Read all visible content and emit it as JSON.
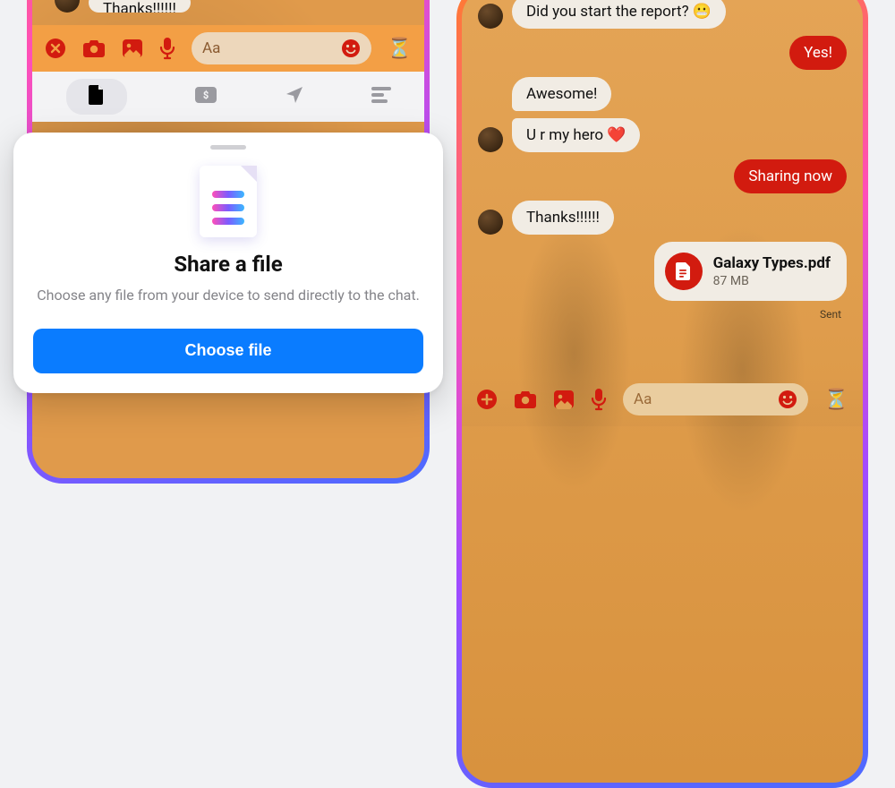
{
  "colors": {
    "accent": "#d21b0f",
    "primary_button": "#0a7cff"
  },
  "left": {
    "peek_message": "Thanks!!!!!!",
    "composer": {
      "placeholder": "Aa"
    },
    "sheet": {
      "title": "Share a file",
      "description": "Choose any file from your device to send directly to the chat.",
      "button": "Choose file"
    }
  },
  "right": {
    "messages": [
      {
        "side": "left",
        "text": "Did you start the report? 😬",
        "show_avatar": true
      },
      {
        "side": "right",
        "text": "Yes!"
      },
      {
        "side": "left",
        "text": "Awesome!",
        "show_avatar": false
      },
      {
        "side": "left",
        "text": "U r my hero ❤️",
        "show_avatar": true
      },
      {
        "side": "right",
        "text": "Sharing now"
      },
      {
        "side": "left",
        "text": "Thanks!!!!!!",
        "show_avatar": true
      }
    ],
    "file": {
      "name": "Galaxy Types.pdf",
      "size": "87 MB"
    },
    "status": "Sent",
    "composer": {
      "placeholder": "Aa"
    }
  }
}
